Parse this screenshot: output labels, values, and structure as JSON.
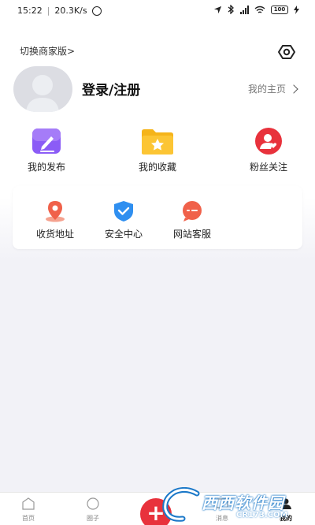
{
  "status_bar": {
    "time": "15:22",
    "net_speed": "20.3K/s",
    "battery": "100"
  },
  "header": {
    "switch_label": "切换商家版>",
    "login_label": "登录/注册",
    "homepage_label": "我的主页"
  },
  "quick_actions": [
    {
      "label": "我的发布",
      "icon": "edit-icon",
      "color": "#8b5cf6"
    },
    {
      "label": "我的收藏",
      "icon": "star-folder-icon",
      "color": "#f5b41a"
    },
    {
      "label": "粉丝关注",
      "icon": "user-heart-icon",
      "color": "#e8323c"
    }
  ],
  "services": [
    {
      "label": "收货地址",
      "icon": "location-pin-icon",
      "color": "#f0614a"
    },
    {
      "label": "安全中心",
      "icon": "shield-check-icon",
      "color": "#2f8ff0"
    },
    {
      "label": "网站客服",
      "icon": "chat-bubble-icon",
      "color": "#f0614a"
    }
  ],
  "bottom_nav": {
    "home": "首页",
    "circle": "圈子",
    "messages": "消息",
    "mine": "我的"
  },
  "watermark": {
    "text": "西西软件园",
    "sub": "CR173.COM"
  }
}
